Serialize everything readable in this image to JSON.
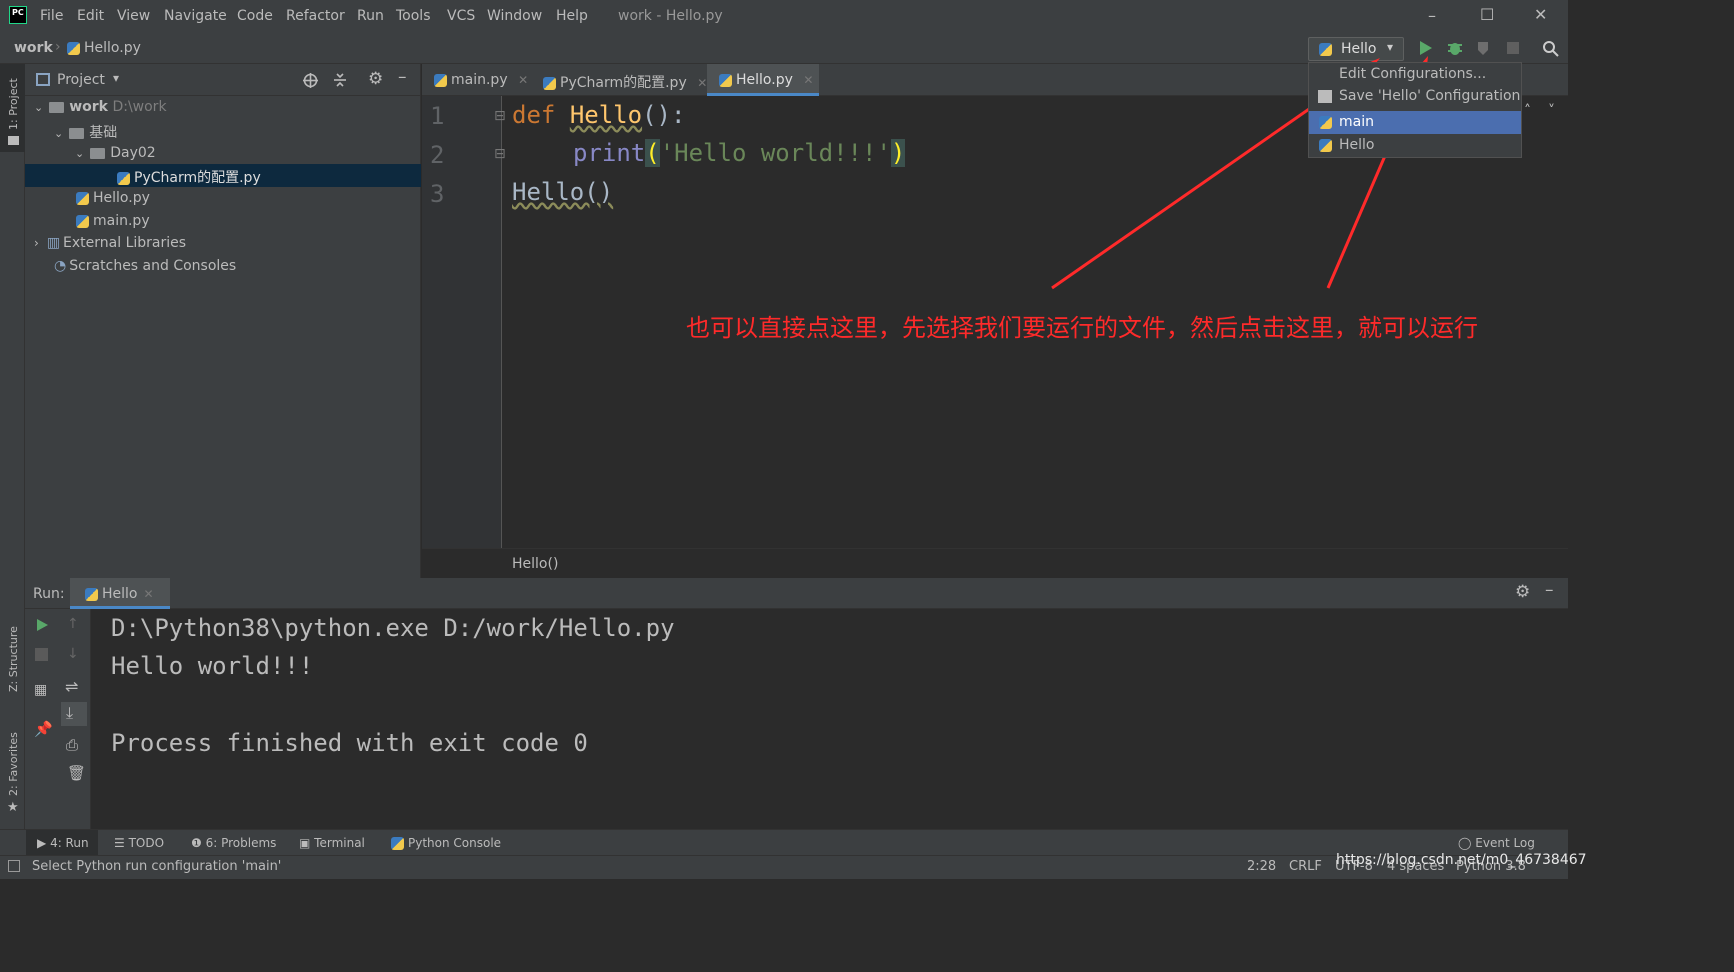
{
  "app": {
    "window_title": "work - Hello.py"
  },
  "menu": [
    "File",
    "Edit",
    "View",
    "Navigate",
    "Code",
    "Refactor",
    "Run",
    "Tools",
    "VCS",
    "Window",
    "Help"
  ],
  "navbar": {
    "project": "work",
    "file": "Hello.py",
    "run_config": "Hello"
  },
  "project_panel": {
    "title": "Project",
    "strip_label": "1: Project",
    "tree": [
      {
        "label": "work",
        "extra": "D:\\work"
      },
      {
        "label": "基础"
      },
      {
        "label": "Day02"
      },
      {
        "label": "PyCharm的配置.py"
      },
      {
        "label": "Hello.py"
      },
      {
        "label": "main.py"
      },
      {
        "label": "External Libraries"
      },
      {
        "label": "Scratches and Consoles"
      }
    ]
  },
  "tabs": [
    {
      "label": "main.py"
    },
    {
      "label": "PyCharm的配置.py"
    },
    {
      "label": "Hello.py",
      "active": true
    }
  ],
  "editor": {
    "line_numbers": [
      "1",
      "2",
      "3"
    ],
    "line1": {
      "kw": "def",
      "name": "Hello",
      "rest": "():"
    },
    "line2": {
      "fn": "print",
      "open": "(",
      "str": "'Hello world!!!'",
      "close": ")"
    },
    "line3": "Hello()",
    "breadcrumb": "Hello()"
  },
  "dropdown": {
    "items": [
      "Edit Configurations...",
      "Save 'Hello' Configuration",
      "main",
      "Hello"
    ],
    "selected": "main"
  },
  "annotation": "也可以直接点这里，先选择我们要运行的文件，然后点击这里，就可以运行",
  "run_panel": {
    "label": "Run:",
    "tab": "Hello",
    "output": [
      "D:\\Python38\\python.exe D:/work/Hello.py",
      "Hello world!!!",
      "",
      "Process finished with exit code 0"
    ]
  },
  "left_strip_bottom": [
    "Z: Structure",
    "2: Favorites"
  ],
  "bottom_tools": [
    "4: Run",
    "TODO",
    "6: Problems",
    "Terminal",
    "Python Console",
    "Event Log"
  ],
  "status": {
    "message": "Select Python run configuration 'main'",
    "position": "2:28",
    "line_sep": "CRLF",
    "encoding": "UTF-8",
    "indent": "4 spaces",
    "interpreter": "Python 3.8",
    "watermark": "https://blog.csdn.net/m0_46738467"
  },
  "colors": {
    "annotation": "#ff2a2a",
    "selection": "#4b6eaf",
    "run_green": "#59a869"
  }
}
